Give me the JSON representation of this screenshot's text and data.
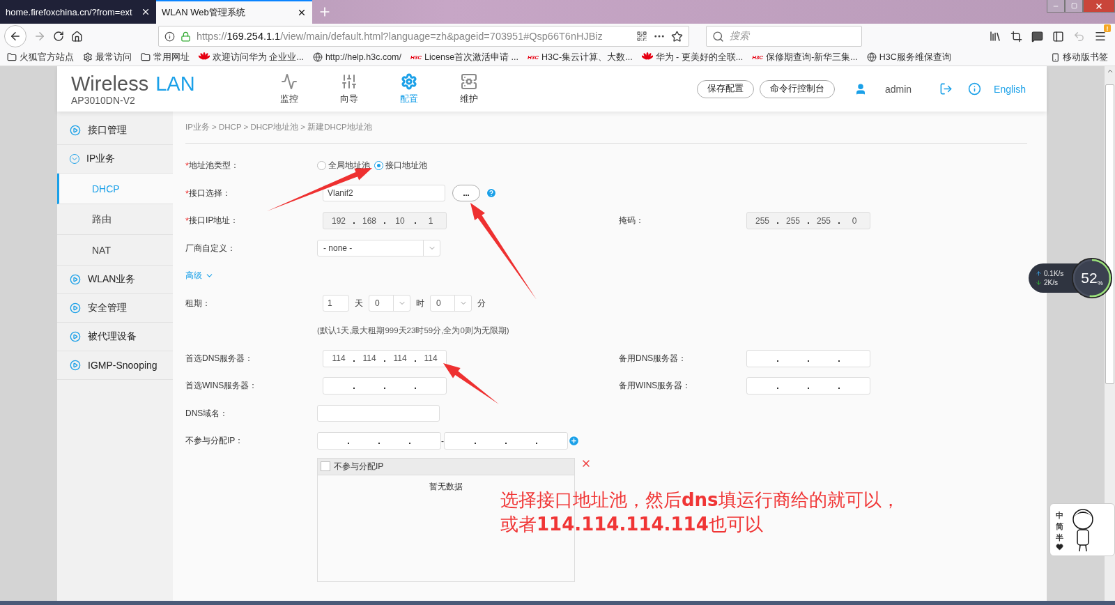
{
  "browser": {
    "tabs": [
      {
        "title": "home.firefoxchina.cn/?from=ext",
        "selected": false
      },
      {
        "title": "WLAN Web管理系统",
        "selected": true
      }
    ],
    "address": {
      "scheme": "https://",
      "host": "169.254.1.1",
      "path": "/view/main/default.html?language=zh&pageid=703951#Qsp66T6nHJBiz"
    },
    "search": {
      "placeholder": "搜索"
    },
    "menu_badge": "!",
    "bookmarks": [
      {
        "kind": "folder",
        "label": "火狐官方站点"
      },
      {
        "kind": "gear",
        "label": "最常访问"
      },
      {
        "kind": "folder",
        "label": "常用网址"
      },
      {
        "kind": "huawei",
        "label": "欢迎访问华为 企业业..."
      },
      {
        "kind": "globe",
        "label": "http://help.h3c.com/"
      },
      {
        "kind": "h3c",
        "logo": "H3C",
        "label": "License首次激活申请 ..."
      },
      {
        "kind": "h3c",
        "logo": "H3C",
        "label": "H3C-集云计算、大数..."
      },
      {
        "kind": "huawei",
        "label": "华为 - 更美好的全联..."
      },
      {
        "kind": "h3c",
        "logo": "H3C",
        "label": "保修期查询-新华三集..."
      },
      {
        "kind": "globe",
        "label": "H3C服务维保查询"
      }
    ],
    "mobile_bookmarks": "移动版书签"
  },
  "app": {
    "logo": {
      "word": "Wireless",
      "accent": "LAN"
    },
    "model": "AP3010DN-V2",
    "nav": [
      {
        "kind": "monitor",
        "label": "监控",
        "selected": false
      },
      {
        "kind": "wizard",
        "label": "向导",
        "selected": false
      },
      {
        "kind": "config",
        "label": "配置",
        "selected": true
      },
      {
        "kind": "maintain",
        "label": "维护",
        "selected": false
      }
    ],
    "buttons": [
      "保存配置",
      "命令行控制台"
    ],
    "user": "admin",
    "language": "English"
  },
  "sidebar": {
    "items": [
      {
        "label": "接口管理",
        "expanded": false
      },
      {
        "label": "IP业务",
        "expanded": true,
        "children": [
          {
            "label": "DHCP",
            "selected": true
          },
          {
            "label": "路由",
            "selected": false
          },
          {
            "label": "NAT",
            "selected": false
          }
        ]
      },
      {
        "label": "WLAN业务",
        "expanded": false
      },
      {
        "label": "安全管理",
        "expanded": false
      },
      {
        "label": "被代理设备",
        "expanded": false
      },
      {
        "label": "IGMP-Snooping",
        "expanded": false
      }
    ]
  },
  "breadcrumb": "IP业务 > DHCP > DHCP地址池 > 新建DHCP地址池",
  "form": [
    {
      "kind": "radio",
      "label": "地址池类型：",
      "required_mark": "*",
      "options": [
        {
          "label": "全局地址池",
          "selected": false
        },
        {
          "label": "接口地址池",
          "selected": true
        }
      ]
    },
    {
      "kind": "picker",
      "label": "接口选择：",
      "required_mark": "*",
      "value": "Vlanif2",
      "button": "..."
    },
    {
      "kind": "ip",
      "label": "接口IP地址：",
      "required_mark": "*",
      "disabled": true,
      "octets": [
        "192",
        "168",
        "10",
        "1"
      ],
      "right": {
        "label": "掩码：",
        "disabled": true,
        "octets": [
          "255",
          "255",
          "255",
          "0"
        ]
      }
    },
    {
      "kind": "select",
      "label": "厂商自定义：",
      "value": "- none -"
    },
    {
      "kind": "toggle",
      "label": "高级",
      "expanded": true
    },
    {
      "kind": "lease",
      "label": "租期：",
      "days": "1",
      "day_unit": "天",
      "hours": "0",
      "hour_unit": "时",
      "minutes": "0",
      "minute_unit": "分"
    },
    {
      "kind": "note",
      "text": "(默认1天,最大租期999天23时59分,全为0则为无限期)"
    },
    {
      "kind": "ip",
      "label": "首选DNS服务器：",
      "disabled": false,
      "octets": [
        "114",
        "114",
        "114",
        "114"
      ],
      "right": {
        "label": "备用DNS服务器：",
        "disabled": false
      }
    },
    {
      "kind": "ip",
      "label": "首选WINS服务器：",
      "disabled": false,
      "right": {
        "label": "备用WINS服务器：",
        "disabled": false
      }
    },
    {
      "kind": "text",
      "label": "DNS域名："
    },
    {
      "kind": "range",
      "label": "不参与分配IP：",
      "separator": "-"
    },
    {
      "kind": "table",
      "column": "不参与分配IP",
      "checked": false,
      "empty": "暂无数据"
    }
  ],
  "annotation": [
    "选择接口地址池，然后**dns**填运行商给的就可以，",
    "或者**114.114.114.114**也可以"
  ],
  "speed_widget": {
    "up": "0.1",
    "up_unit": "K/s",
    "down": "2",
    "down_unit": "K/s",
    "percent": "52",
    "percent_unit": "%",
    "level": 0.52
  },
  "ime": {
    "chars": [
      "中",
      "简",
      "半"
    ]
  }
}
